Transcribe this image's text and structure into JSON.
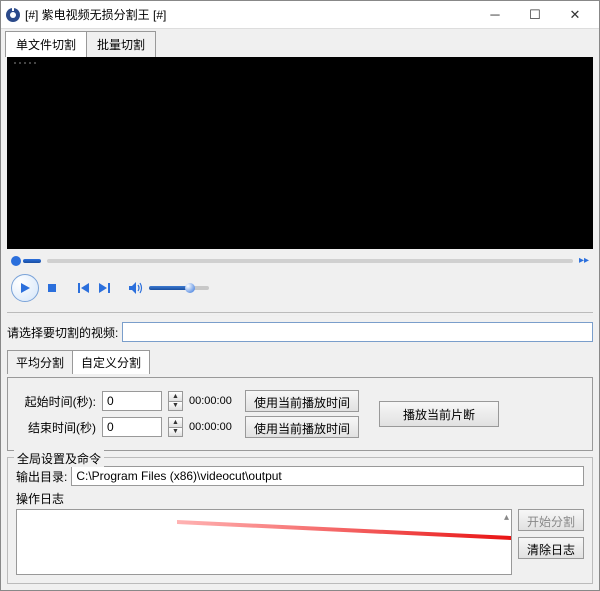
{
  "window": {
    "title": "[#] 紫电视频无损分割王 [#]"
  },
  "tabs": {
    "single": "单文件切割",
    "batch": "批量切割"
  },
  "video": {
    "select_label": "请选择要切割的视频:",
    "select_value": ""
  },
  "subtabs": {
    "avg": "平均分割",
    "custom": "自定义分割"
  },
  "time": {
    "start_label": "起始时间(秒):",
    "end_label": "结束时间(秒)",
    "start_value": "0",
    "end_value": "0",
    "start_code": "00:00:00",
    "end_code": "00:00:00",
    "use_play_time": "使用当前播放时间",
    "play_segment": "播放当前片断"
  },
  "global": {
    "legend": "全局设置及命令",
    "outdir_label": "输出目录:",
    "outdir_value": "C:\\Program Files (x86)\\videocut\\output"
  },
  "log": {
    "label": "操作日志",
    "start_btn": "开始分割",
    "clear_btn": "清除日志"
  }
}
